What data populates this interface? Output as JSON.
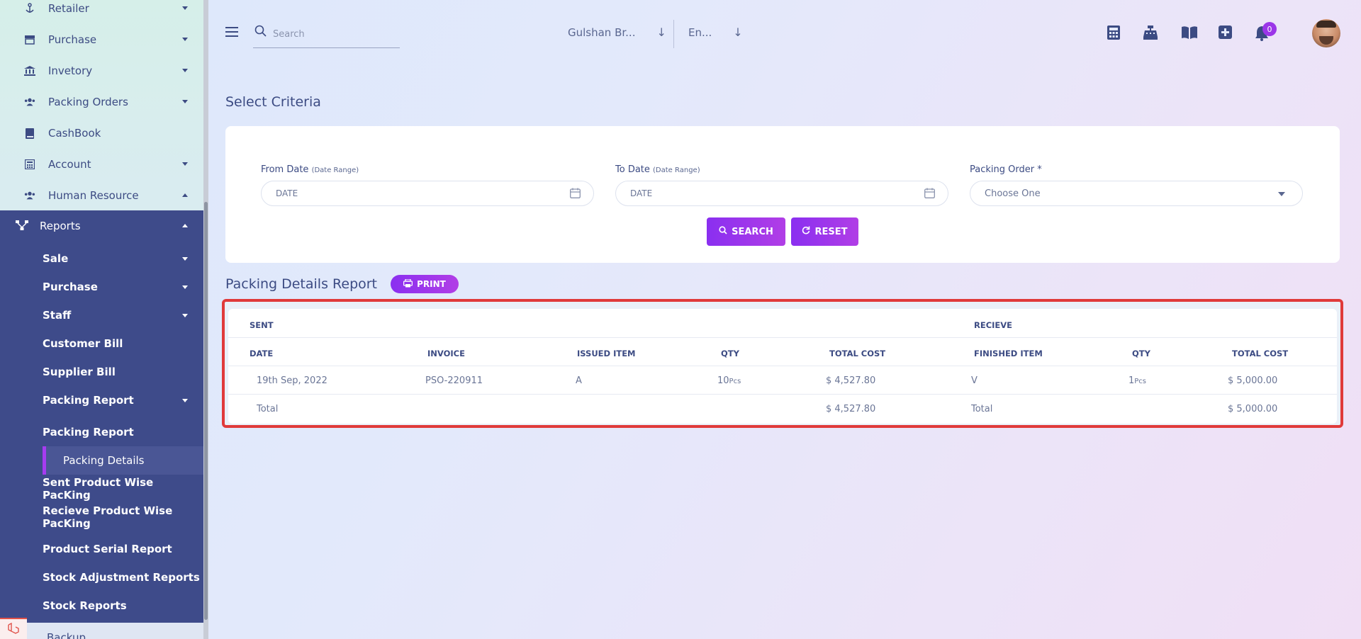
{
  "sidebar": {
    "top_items": [
      {
        "label": "Retailer",
        "icon": "retailer-icon"
      },
      {
        "label": "Purchase",
        "icon": "store-icon"
      },
      {
        "label": "Invetory",
        "icon": "bank-icon"
      },
      {
        "label": "Packing Orders",
        "icon": "users-icon"
      },
      {
        "label": "CashBook",
        "icon": "book-icon"
      },
      {
        "label": "Account",
        "icon": "calculator-icon"
      },
      {
        "label": "Human Resource",
        "icon": "users-icon"
      }
    ],
    "reports_label": "Reports",
    "report_items": [
      {
        "label": "Sale"
      },
      {
        "label": "Purchase"
      },
      {
        "label": "Staff"
      },
      {
        "label": "Customer Bill"
      },
      {
        "label": "Supplier Bill"
      },
      {
        "label": "Packing Report"
      },
      {
        "label": "Packing Report"
      },
      {
        "label": "Packing Details"
      },
      {
        "label": "Sent Product Wise PacKing"
      },
      {
        "label": "Recieve Product Wise PacKing"
      },
      {
        "label": "Product Serial Report"
      },
      {
        "label": "Stock Adjustment Reports"
      },
      {
        "label": "Stock Reports"
      }
    ],
    "backup_label": "Backup"
  },
  "topbar": {
    "search_placeholder": "Search",
    "branch": "Gulshan Br...",
    "language": "En...",
    "notification_count": "0"
  },
  "criteria": {
    "title": "Select Criteria",
    "from_label": "From Date",
    "from_hint": "(Date Range)",
    "from_placeholder": "DATE",
    "to_label": "To Date",
    "to_hint": "(Date Range)",
    "to_placeholder": "DATE",
    "order_label": "Packing Order *",
    "order_value": "Choose One",
    "search_btn": "SEARCH",
    "reset_btn": "RESET"
  },
  "report": {
    "title": "Packing Details Report",
    "print_btn": "PRINT",
    "group_sent": "SENT",
    "group_recieve": "RECIEVE",
    "headers": [
      "DATE",
      "INVOICE",
      "ISSUED ITEM",
      "QTY",
      "TOTAL COST",
      "FINISHED ITEM",
      "QTY",
      "TOTAL COST"
    ],
    "row": {
      "date": "19th Sep, 2022",
      "invoice": "PSO-220911",
      "issued_item": "A",
      "qty_num": "10",
      "qty_unit": "Pcs",
      "total_cost": "$ 4,527.80",
      "finished_item": "V",
      "fqty_num": "1",
      "fqty_unit": "Pcs",
      "ftotal_cost": "$ 5,000.00"
    },
    "total_label": "Total",
    "total_sent": "$ 4,527.80",
    "total_recieve_label": "Total",
    "total_recieve": "$ 5,000.00"
  }
}
